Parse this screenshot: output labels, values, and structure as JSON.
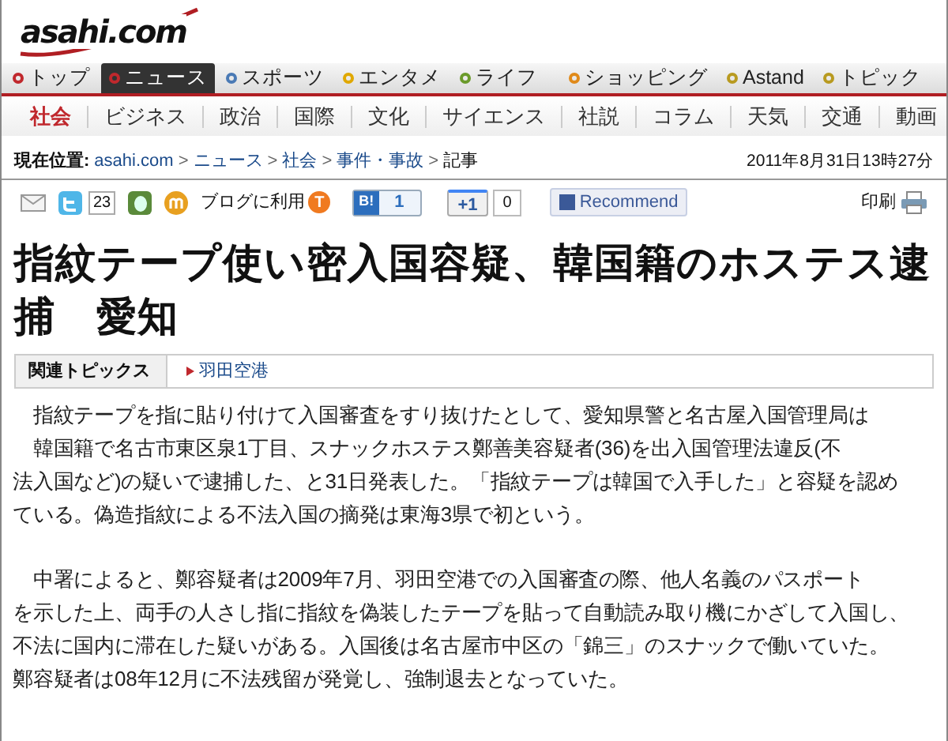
{
  "logo": {
    "text": "asahi.com"
  },
  "main_nav": [
    {
      "label": "トップ",
      "color": "#c0282d",
      "selected": false
    },
    {
      "label": "ニュース",
      "color": "#c0282d",
      "selected": true
    },
    {
      "label": "スポーツ",
      "color": "#4a7ab5",
      "selected": false
    },
    {
      "label": "エンタメ",
      "color": "#e0a800",
      "selected": false
    },
    {
      "label": "ライフ",
      "color": "#6a9a2a",
      "selected": false
    },
    {
      "label": "ショッピング",
      "color": "#e08a1a",
      "selected": false
    },
    {
      "label": "Astand",
      "color": "#b89a20",
      "selected": false
    },
    {
      "label": "トピック",
      "color": "#b89a20",
      "selected": false
    }
  ],
  "sub_nav": [
    {
      "label": "社会",
      "selected": true
    },
    {
      "label": "ビジネス",
      "selected": false
    },
    {
      "label": "政治",
      "selected": false
    },
    {
      "label": "国際",
      "selected": false
    },
    {
      "label": "文化",
      "selected": false
    },
    {
      "label": "サイエンス",
      "selected": false
    },
    {
      "label": "社説",
      "selected": false
    },
    {
      "label": "コラム",
      "selected": false
    },
    {
      "label": "天気",
      "selected": false
    },
    {
      "label": "交通",
      "selected": false
    },
    {
      "label": "動画",
      "selected": false
    }
  ],
  "breadcrumb": {
    "label": "現在位置:",
    "links": [
      "asahi.com",
      "ニュース",
      "社会",
      "事件・事故"
    ],
    "separator": ">",
    "current": "記事",
    "timestamp": "2011年8月31日13時27分"
  },
  "share_bar": {
    "tweet_count": "23",
    "blog_label": "ブログに利用",
    "blog_icon": "T",
    "hatena_label": "B!",
    "hatena_count": "1",
    "plusone_label": "+1",
    "plusone_count": "0",
    "recommend_label": "Recommend",
    "print_label": "印刷"
  },
  "headline": "指紋テープ使い密入国容疑、韓国籍のホステス逮捕　愛知",
  "related_topics": {
    "label": "関連トピックス",
    "links": [
      "羽田空港"
    ]
  },
  "paragraphs": [
    {
      "lines": [
        "　指紋テープを指に貼り付けて入国審査をすり抜けたとして、愛知県警と名古屋入国管理局は",
        "　韓国籍で名古市東区泉1丁目、スナックホステス鄭善美容疑者(36)を出入国管理法違反(不",
        "法入国など)の疑いで逮捕した、と31日発表した。「指紋テープは韓国で入手した」と容疑を認め",
        "ている。偽造指紋による不法入国の摘発は東海3県で初という。"
      ]
    },
    {
      "lines": [
        "　中署によると、鄭容疑者は2009年7月、羽田空港での入国審査の際、他人名義のパスポート",
        "を示した上、両手の人さし指に指紋を偽装したテープを貼って自動読み取り機にかざして入国し、",
        "不法に国内に滞在した疑いがある。入国後は名古屋市中区の「錦三」のスナックで働いていた。",
        "鄭容疑者は08年12月に不法残留が発覚し、強制退去となっていた。"
      ]
    }
  ]
}
